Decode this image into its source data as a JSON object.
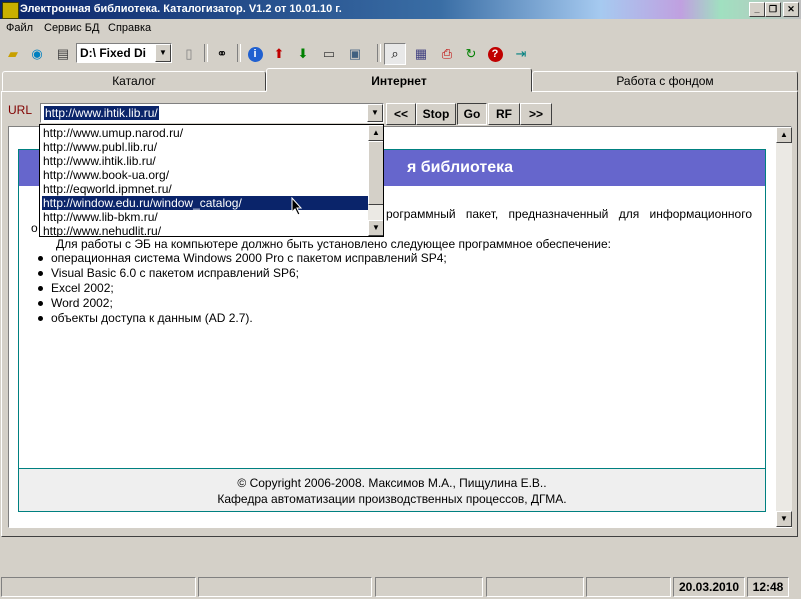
{
  "window": {
    "title": "Электронная библиотека. Каталогизатор. V1.2 от 10.01.10 г.",
    "minimize": "_",
    "maximize": "❐",
    "close": "✕"
  },
  "menu": {
    "items": [
      "Файл",
      "Сервис БД",
      "Справка"
    ]
  },
  "toolbar": {
    "drive": "D:\\ Fixed Di"
  },
  "tabs": [
    "Каталог",
    "Интернет",
    "Работа с фондом"
  ],
  "url": {
    "label": "URL",
    "value": "http://www.ihtik.lib.ru/",
    "dropdown": [
      "http://www.umup.narod.ru/",
      "http://www.publ.lib.ru/",
      "http://www.ihtik.lib.ru/",
      "http://www.book-ua.org/",
      "http://eqworld.ipmnet.ru/",
      "http://window.edu.ru/window_catalog/",
      "http://www.lib-bkm.ru/",
      "http://www.nehudlit.ru/"
    ],
    "selected_index": 5
  },
  "nav": {
    "back": "<<",
    "stop": "Stop",
    "go": "Go",
    "rf": "RF",
    "forward": ">>"
  },
  "page": {
    "header": "я библиотека",
    "intro": "рограммный пакет, предназначенный для информационного",
    "intro_cont": "о",
    "requirements_intro": "Для работы с ЭБ на компьютере должно быть установлено следующее программное обеспечение:",
    "requirements": [
      "операционная система Windows 2000 Pro с пакетом исправлений SP4;",
      "Visual Basic 6.0 с пакетом исправлений SP6;",
      "Excel 2002;",
      "Word 2002;",
      "объекты доступа к данным (AD 2.7)."
    ],
    "copyright": "© Copyright 2006-2008. Максимов М.А., Пищулина Е.В..",
    "department": "Кафедра автоматизации производственных процессов, ДГМА."
  },
  "status": {
    "date": "20.03.2010",
    "time": "12:48"
  }
}
